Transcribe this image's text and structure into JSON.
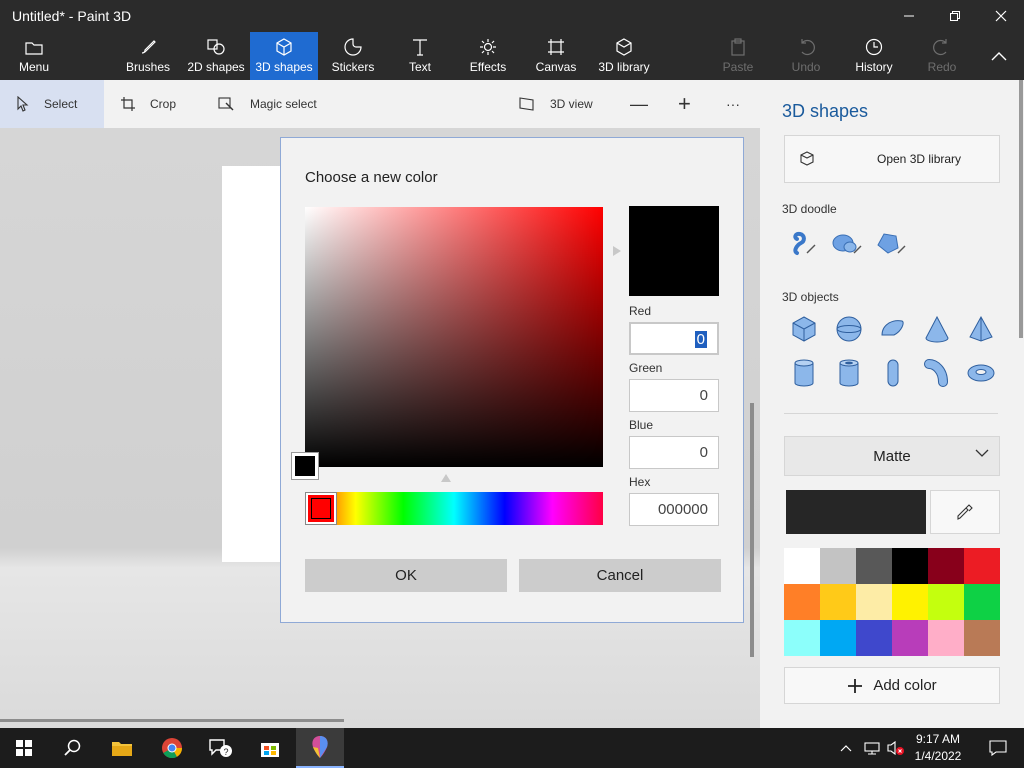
{
  "window": {
    "title": "Untitled* - Paint 3D"
  },
  "ribbon": {
    "menu_label": "Menu",
    "tabs": [
      {
        "label": "Brushes",
        "icon": "brush-icon"
      },
      {
        "label": "2D shapes",
        "icon": "2d-shapes-icon"
      },
      {
        "label": "3D shapes",
        "icon": "3d-cube-icon",
        "active": true
      },
      {
        "label": "Stickers",
        "icon": "sticker-icon"
      },
      {
        "label": "Text",
        "icon": "text-icon"
      },
      {
        "label": "Effects",
        "icon": "sun-icon"
      },
      {
        "label": "Canvas",
        "icon": "canvas-icon"
      },
      {
        "label": "3D library",
        "icon": "3d-library-icon"
      }
    ],
    "actions": [
      {
        "label": "Paste",
        "enabled": false
      },
      {
        "label": "Undo",
        "enabled": false
      },
      {
        "label": "History",
        "enabled": true
      },
      {
        "label": "Redo",
        "enabled": false
      }
    ]
  },
  "toolbar": {
    "select": "Select",
    "crop": "Crop",
    "magic_select": "Magic select",
    "view_3d": "3D view",
    "zoom_out": "—",
    "zoom_in": "+",
    "more": "···"
  },
  "dialog": {
    "title": "Choose a new color",
    "selected_color": "#000000",
    "hue_color": "#ff0000",
    "red_label": "Red",
    "red_value": "0",
    "green_label": "Green",
    "green_value": "0",
    "blue_label": "Blue",
    "blue_value": "0",
    "hex_label": "Hex",
    "hex_value": "000000",
    "ok": "OK",
    "cancel": "Cancel"
  },
  "panel": {
    "title": "3D shapes",
    "open_library": "Open 3D library",
    "doodle_label": "3D doodle",
    "doodle_tools": [
      "sharp-edge-doodle-icon",
      "soft-edge-doodle-icon",
      "stone-doodle-icon"
    ],
    "objects_label": "3D objects",
    "objects": [
      "cube-icon",
      "sphere-icon",
      "hemisphere-icon",
      "cone-icon",
      "pyramid-icon",
      "cylinder-icon",
      "tube-icon",
      "capsule-icon",
      "bent-tube-icon",
      "donut-icon"
    ],
    "material": "Matte",
    "current_color": "#262626",
    "swatches": [
      "#ffffff",
      "#c3c3c3",
      "#585858",
      "#000000",
      "#88001b",
      "#ec1c24",
      "#ff7f27",
      "#ffca18",
      "#fdeca6",
      "#fff200",
      "#c4ff0e",
      "#0ed145",
      "#8cfffb",
      "#00a8f3",
      "#3f48cc",
      "#b83dba",
      "#ffaec8",
      "#b97a56"
    ],
    "add_color": "Add color"
  },
  "taskbar": {
    "apps": [
      "windows-start-icon",
      "search-icon",
      "file-explorer-icon",
      "chrome-icon",
      "feedback-hub-icon",
      "store-icon",
      "paint-3d-icon"
    ],
    "time": "9:17 AM",
    "date": "1/4/2022"
  }
}
